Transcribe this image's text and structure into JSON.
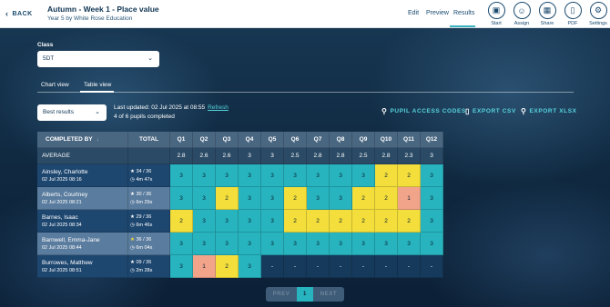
{
  "header": {
    "back_label": "BACK",
    "title": "Autumn - Week 1 - Place value",
    "subtitle": "Year 5 by White Rose Education",
    "nav": [
      "Edit",
      "Preview",
      "Results"
    ],
    "actions": [
      {
        "label": "Start",
        "icon": "presentation-icon"
      },
      {
        "label": "Assign",
        "icon": "assign-icon"
      },
      {
        "label": "Share",
        "icon": "qr-icon"
      },
      {
        "label": "PDF",
        "icon": "pdf-icon"
      },
      {
        "label": "Settings",
        "icon": "gear-icon"
      }
    ]
  },
  "class_label": "Class",
  "class_value": "5DT",
  "tabs": [
    "Chart view",
    "Table view"
  ],
  "active_tab": "Table view",
  "sort_value": "Best results",
  "last_updated": "Last updated: 02 Jul 2025 at 08:55",
  "refresh_label": "Refresh",
  "completed_text": "4 of 6 pupils completed",
  "actions": [
    "PUPIL ACCESS CODES",
    "EXPORT CSV",
    "EXPORT XLSX"
  ],
  "table": {
    "col_completed_by": "COMPLETED BY",
    "col_total": "TOTAL",
    "questions": [
      "Q1",
      "Q2",
      "Q3",
      "Q4",
      "Q5",
      "Q6",
      "Q7",
      "Q8",
      "Q9",
      "Q10",
      "Q11",
      "Q12"
    ],
    "average_label": "AVERAGE",
    "averages": [
      "2.8",
      "2.6",
      "2.6",
      "3",
      "3",
      "2.5",
      "2.8",
      "2.8",
      "2.5",
      "2.8",
      "2.3",
      "3"
    ],
    "rows": [
      {
        "name": "Ainsley, Charlotte",
        "date": "02 Jul 2025 08:16",
        "score": "34 / 36",
        "time": "4m 47s",
        "scores": [
          "3",
          "3",
          "3",
          "3",
          "3",
          "3",
          "3",
          "3",
          "3",
          "2",
          "2",
          "3"
        ]
      },
      {
        "name": "Alberts, Courtney",
        "date": "02 Jul 2025 08:21",
        "score": "30 / 36",
        "time": "6m 29s",
        "scores": [
          "3",
          "3",
          "2",
          "3",
          "3",
          "2",
          "3",
          "3",
          "2",
          "2",
          "1",
          "3"
        ]
      },
      {
        "name": "Barnes, Isaac",
        "date": "02 Jul 2025 08:34",
        "score": "29 / 36",
        "time": "6m 46s",
        "scores": [
          "2",
          "3",
          "3",
          "3",
          "3",
          "2",
          "2",
          "2",
          "2",
          "2",
          "2",
          "3"
        ]
      },
      {
        "name": "Barnwell, Emma-Jane",
        "date": "02 Jul 2025 08:44",
        "score": "36 / 36",
        "time": "6m 04s",
        "scores": [
          "3",
          "3",
          "3",
          "3",
          "3",
          "3",
          "3",
          "3",
          "3",
          "3",
          "3",
          "3"
        ]
      },
      {
        "name": "Burrowes, Matthew",
        "date": "02 Jul 2025 08:51",
        "score": "09 / 36",
        "time": "2m 28s",
        "scores": [
          "3",
          "1",
          "2",
          "3",
          "-",
          "-",
          "-",
          "-",
          "-",
          "-",
          "-",
          "-"
        ]
      }
    ]
  },
  "pagination": {
    "prev": "PREV",
    "page": "1",
    "next": "NEXT"
  },
  "colors": {
    "score_3": "#27b4bf",
    "score_2": "#f3de3b",
    "score_1": "#f2a48b",
    "accent": "#56d3dc"
  }
}
